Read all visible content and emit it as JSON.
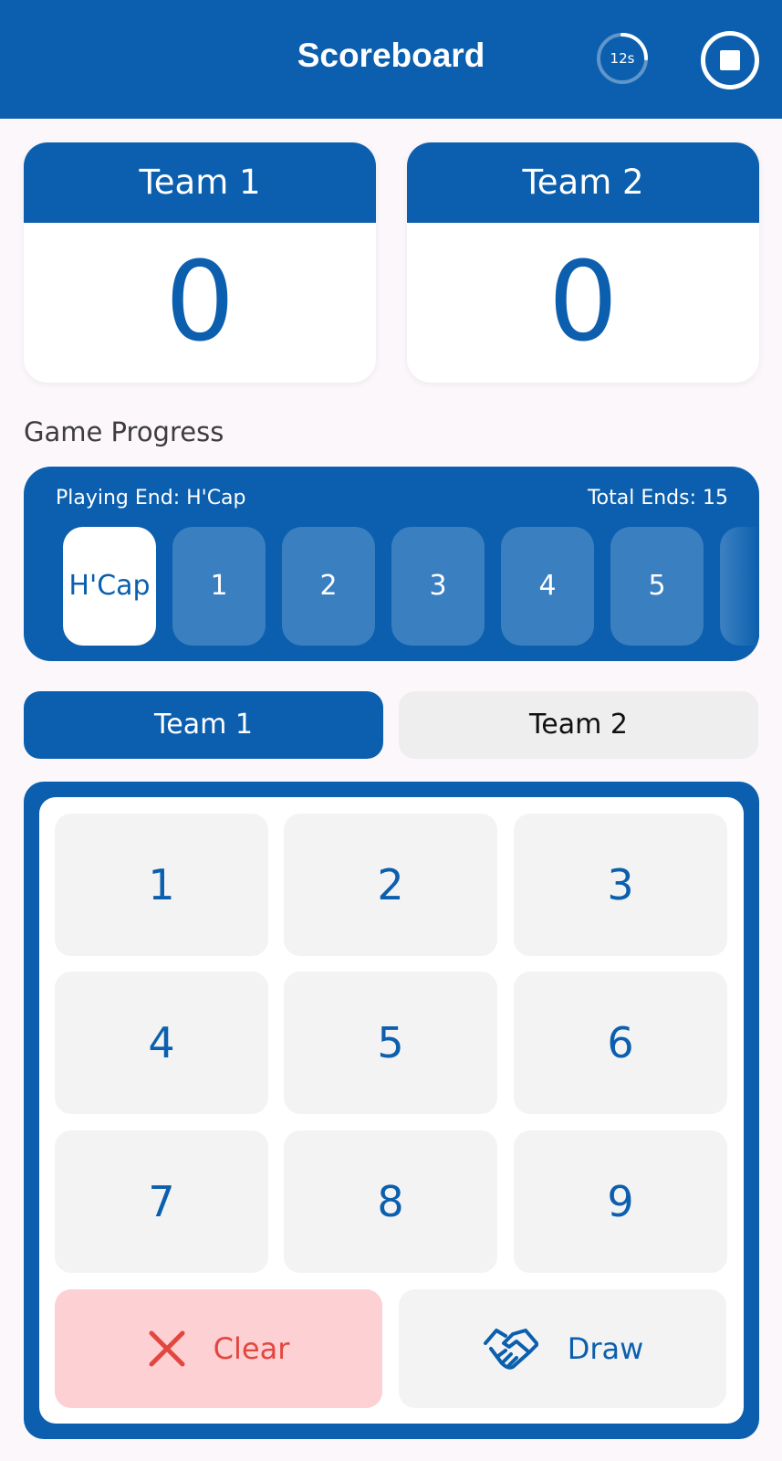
{
  "app_bar": {
    "title": "Scoreboard",
    "timer_label": "12s",
    "timer_fraction": 0.25
  },
  "teams": [
    {
      "name": "Team 1",
      "score": "0"
    },
    {
      "name": "Team 2",
      "score": "0"
    }
  ],
  "progress": {
    "section_label": "Game Progress",
    "playing_end": "Playing End: H'Cap",
    "total_ends": "Total Ends: 15",
    "ends": [
      "H'Cap",
      "1",
      "2",
      "3",
      "4",
      "5"
    ]
  },
  "team_tabs": {
    "tab1": "Team 1",
    "tab2": "Team 2"
  },
  "keypad": {
    "keys": [
      "1",
      "2",
      "3",
      "4",
      "5",
      "6",
      "7",
      "8",
      "9"
    ],
    "clear_label": "Clear",
    "draw_label": "Draw"
  },
  "colors": {
    "primary": "#0b5fae",
    "clear_bg": "#fdd0d3",
    "clear_fg": "#e2473f"
  }
}
